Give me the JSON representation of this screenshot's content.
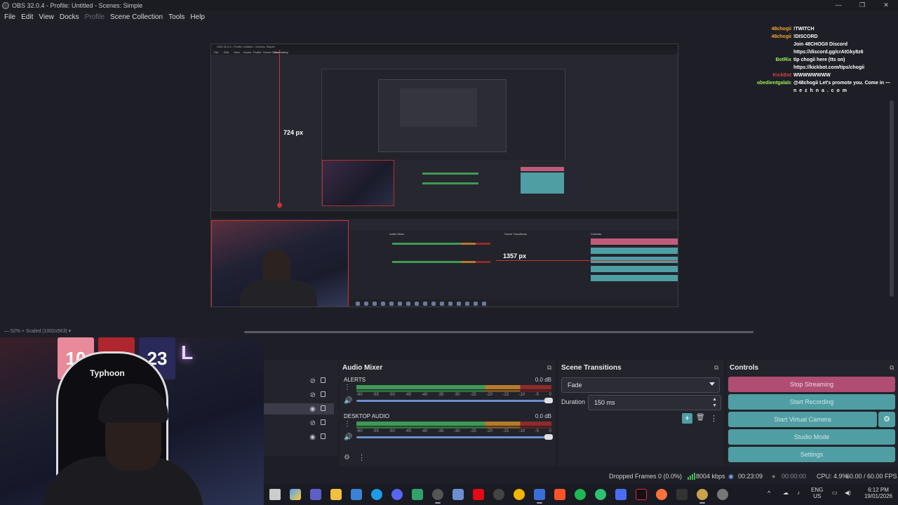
{
  "window": {
    "title": "OBS 32.0.4 - Profile: Untitled - Scenes: Simple",
    "minimize": "—",
    "maximize": "❐",
    "close": "✕"
  },
  "menu": {
    "items": [
      "File",
      "Edit",
      "View",
      "Docks",
      "Profile",
      "Scene Collection",
      "Tools",
      "Help"
    ]
  },
  "preview": {
    "height_measure": "724 px",
    "width_measure": "1357 px",
    "zoom": "52%",
    "scaled": "Scaled (1002x563)"
  },
  "webcam": {
    "chair_brand": "Typhoon",
    "jersey_left": "10",
    "jersey_right": "23"
  },
  "audio_mixer": {
    "title": "Audio Mixer",
    "channels": [
      {
        "name": "ALERTS",
        "level": "0.0 dB"
      },
      {
        "name": "DESKTOP AUDIO",
        "level": "0.0 dB"
      }
    ],
    "ticks": [
      "-60",
      "-55",
      "-50",
      "-45",
      "-40",
      "-35",
      "-30",
      "-25",
      "-20",
      "-15",
      "-10",
      "-5",
      "0"
    ]
  },
  "scene_transitions": {
    "title": "Scene Transitions",
    "selected": "Fade",
    "duration_label": "Duration",
    "duration_value": "150 ms"
  },
  "controls": {
    "title": "Controls",
    "stop_streaming": "Stop Streaming",
    "start_recording": "Start Recording",
    "start_virtual_camera": "Start Virtual Camera",
    "studio_mode": "Studio Mode",
    "settings": "Settings"
  },
  "status": {
    "dropped_frames": "Dropped Frames 0 (0.0%)",
    "bitrate": "8004 kbps",
    "stream_time": "00:23:09",
    "record_time": "00:00:00",
    "cpu": "CPU: 4.9%",
    "fps": "60.00 / 60.00 FPS"
  },
  "taskbar": {
    "lang_top": "ENG",
    "lang_bottom": "US",
    "time": "6:12 PM",
    "date": "19/01/2026"
  },
  "chat": [
    {
      "user": "48chogii",
      "user_color": "#f2a530",
      "message": "!TWITCH"
    },
    {
      "user": "48chogii",
      "user_color": "#f2a530",
      "message": "!DISCORD"
    },
    {
      "user": "",
      "user_color": "#d04040",
      "message": "Join 48CHOGII Discord"
    },
    {
      "user": "",
      "user_color": "#ffffff",
      "message": "https://discord.gg/crAtGky8z6"
    },
    {
      "user": "BotRix",
      "user_color": "#9cf05a",
      "message": "tip chogii here (tts on)"
    },
    {
      "user": "",
      "user_color": "#ffffff",
      "message": "https://kickbot.com/tips/chogii"
    },
    {
      "user": "KickBot",
      "user_color": "#d04040",
      "message": "WWWWWWWW"
    },
    {
      "user": "obedientgalalc",
      "user_color": "#9cf05a",
      "message": "@48chogii Let's promote you. Come in —"
    },
    {
      "user": "",
      "user_color": "#ffffff",
      "message": "n e z h n a . c o m"
    }
  ],
  "colors": {
    "teal": "#4f9ea3",
    "stop": "#b04d72",
    "bg": "#1e1f26",
    "dock": "#22232b"
  }
}
